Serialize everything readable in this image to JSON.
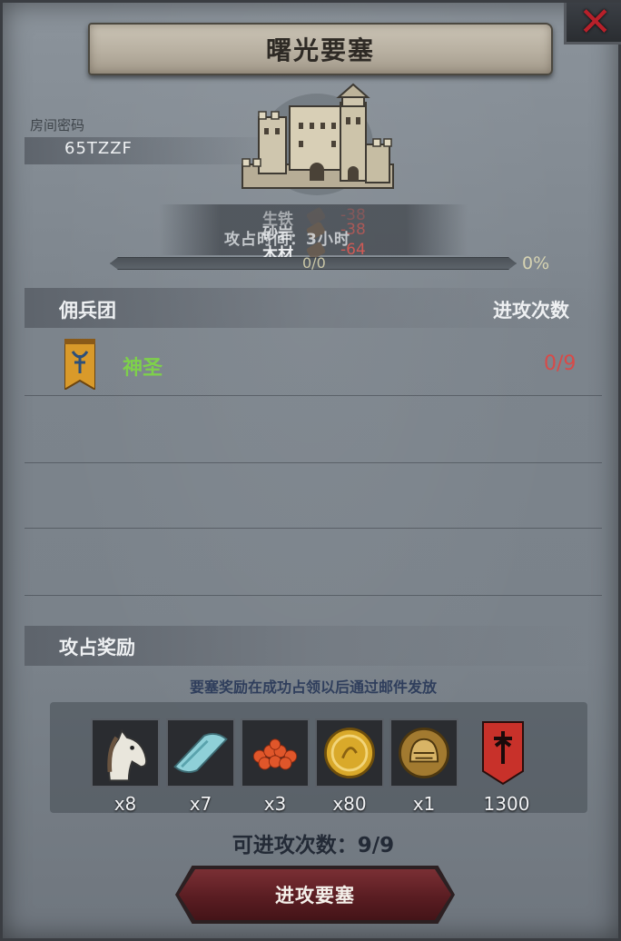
{
  "title": "曙光要塞",
  "room": {
    "label": "房间密码",
    "code": "65TZZF"
  },
  "resources": [
    {
      "name": "生铁",
      "value": "-38"
    },
    {
      "name": "砂岩",
      "value": "-38"
    },
    {
      "name": "木材",
      "value": "-64"
    }
  ],
  "occupy_time": "攻占时间：3小时",
  "progress": {
    "count": "0/0",
    "percent_label": "0%",
    "fraction": 0
  },
  "mercenary": {
    "header": "佣兵团",
    "attack_count_header": "进攻次数",
    "rows": [
      {
        "name": "神圣",
        "count": "0/9"
      }
    ]
  },
  "rewards": {
    "header": "攻占奖励",
    "note": "要塞奖励在成功占领以后通过邮件发放",
    "items": [
      {
        "icon": "horse-icon",
        "qty": "x8"
      },
      {
        "icon": "cloth-icon",
        "qty": "x7"
      },
      {
        "icon": "caviar-icon",
        "qty": "x3"
      },
      {
        "icon": "gold-coin-icon",
        "qty": "x80"
      },
      {
        "icon": "knight-helmet-icon",
        "qty": "x1"
      },
      {
        "icon": "guild-banner-icon",
        "qty": "1300"
      }
    ]
  },
  "attempts": "可进攻次数：9/9",
  "attack_button": "进攻要塞",
  "colors": {
    "guild_green": "#7ed04b",
    "count_red": "#d84a48",
    "button": "#5a1d22"
  }
}
